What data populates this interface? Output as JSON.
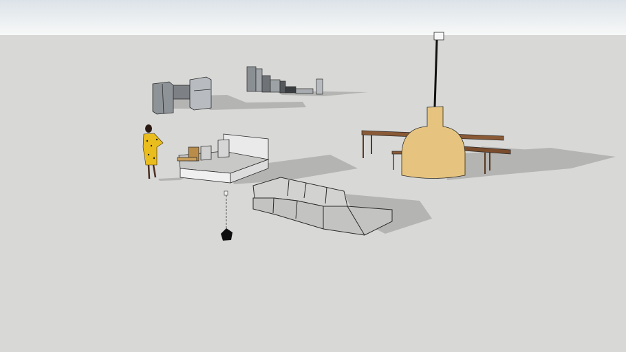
{
  "viewport": {
    "colors": {
      "sky_top": "#dfe6ea",
      "sky_bottom": "#f6f7f7",
      "ground": "#d8d8d6",
      "shadow": "#b3b3b1",
      "edge": "#2a2a2a",
      "sofa": "#c9c9c7",
      "oven": "#e6c47f",
      "wood": "#8a5a36",
      "dress": "#e9bd1d",
      "appliance": "#9ea3a8"
    }
  }
}
